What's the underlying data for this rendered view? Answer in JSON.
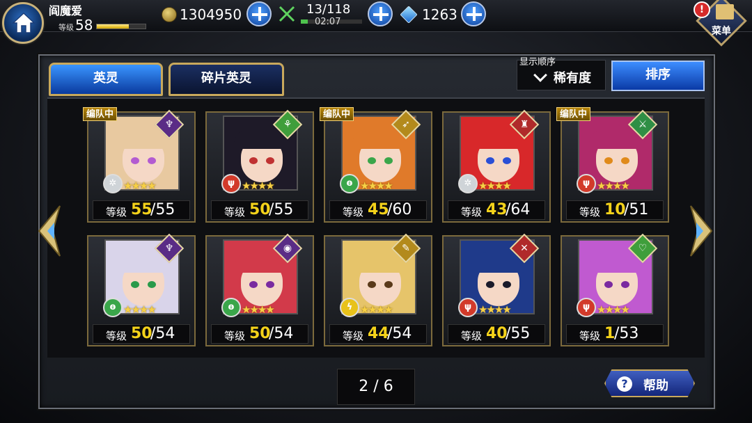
{
  "header": {
    "player_name": "阎魔爱",
    "level_label": "等级",
    "level_value": "58",
    "xp_fraction": 0.65,
    "gold": "1304950",
    "stamina": "13/118",
    "stamina_timer": "02:07",
    "stamina_fraction": 0.11,
    "gems": "1263",
    "menu_label": "菜单",
    "alert_glyph": "!"
  },
  "tabs": [
    {
      "label": "英灵",
      "active": true
    },
    {
      "label": "碎片英灵",
      "active": false
    }
  ],
  "sort": {
    "caption": "显示顺序",
    "selected": "稀有度",
    "button_label": "排序"
  },
  "level_prefix": "等级",
  "party_badge": "编队中",
  "heroes": [
    {
      "cur": "55",
      "max": "/55",
      "in_party": true,
      "class_glyph": "♆",
      "class_color": "#5a2c86",
      "element_glyph": "✲",
      "element_color": "#cfd4d8",
      "hair": "#e8c9a0",
      "eye": "#b35bd1",
      "stars": "★★★★"
    },
    {
      "cur": "50",
      "max": "/55",
      "in_party": false,
      "class_glyph": "⚘",
      "class_color": "#3f9e3b",
      "element_glyph": "ψ",
      "element_color": "#d23a2a",
      "hair": "#1e1a28",
      "eye": "#c03232",
      "stars": "★★★★"
    },
    {
      "cur": "45",
      "max": "/60",
      "in_party": true,
      "class_glyph": "➶",
      "class_color": "#b38a1c",
      "element_glyph": "ɵ",
      "element_color": "#3aa64a",
      "hair": "#e07a2a",
      "eye": "#3aa64a",
      "stars": "★★★★"
    },
    {
      "cur": "43",
      "max": "/64",
      "in_party": false,
      "class_glyph": "♜",
      "class_color": "#b02a2a",
      "element_glyph": "✲",
      "element_color": "#cfd4d8",
      "hair": "#d8282a",
      "eye": "#2a4fd6",
      "stars": "★★★★"
    },
    {
      "cur": "10",
      "max": "/51",
      "in_party": true,
      "class_glyph": "⚔",
      "class_color": "#2f8f45",
      "element_glyph": "ψ",
      "element_color": "#d23a2a",
      "hair": "#b02a6a",
      "eye": "#e08a1a",
      "stars": "★★★★"
    },
    {
      "cur": "50",
      "max": "/54",
      "in_party": false,
      "class_glyph": "♆",
      "class_color": "#5a2c86",
      "element_glyph": "ɵ",
      "element_color": "#3aa64a",
      "hair": "#d9d4ea",
      "eye": "#2a9a4a",
      "stars": "★★★★"
    },
    {
      "cur": "50",
      "max": "/54",
      "in_party": false,
      "class_glyph": "◉",
      "class_color": "#5a2c86",
      "element_glyph": "ɵ",
      "element_color": "#3aa64a",
      "hair": "#d23a4a",
      "eye": "#7a2aa0",
      "stars": "★★★★"
    },
    {
      "cur": "44",
      "max": "/54",
      "in_party": false,
      "class_glyph": "✎",
      "class_color": "#b38a1c",
      "element_glyph": "ϟ",
      "element_color": "#e8c21a",
      "hair": "#e6c46a",
      "eye": "#5a3a1a",
      "stars": "★★★★"
    },
    {
      "cur": "40",
      "max": "/55",
      "in_party": false,
      "class_glyph": "✕",
      "class_color": "#b02a2a",
      "element_glyph": "ψ",
      "element_color": "#d23a2a",
      "hair": "#1f3a8a",
      "eye": "#1a1a2a",
      "stars": "★★★★"
    },
    {
      "cur": "1",
      "max": "/53",
      "in_party": false,
      "class_glyph": "♡",
      "class_color": "#3f9e3b",
      "element_glyph": "ψ",
      "element_color": "#d23a2a",
      "hair": "#c05ad0",
      "eye": "#7a2aa0",
      "stars": "★★★★"
    }
  ],
  "pager": "2 / 6",
  "help_label": "帮助",
  "help_glyph": "?",
  "colors": {
    "accent_blue": "#1e6be0",
    "gold_trim": "#c9a95c",
    "level_yellow": "#f4d21a"
  }
}
